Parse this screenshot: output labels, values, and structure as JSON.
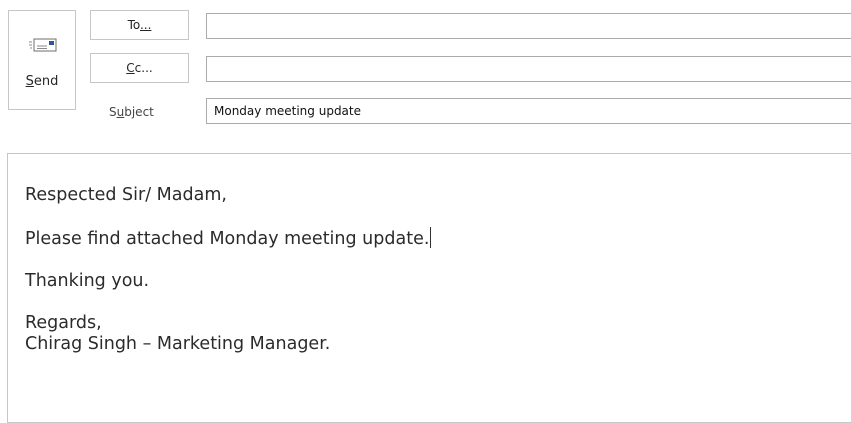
{
  "compose": {
    "send": {
      "label_prefix": "",
      "label_accesskey": "S",
      "label_rest": "end",
      "icon": "send-mail-icon"
    },
    "to": {
      "btn_prefix": "To",
      "btn_accesskey": "",
      "btn_suffix": "...",
      "value": ""
    },
    "cc": {
      "btn_accesskey": "C",
      "btn_rest": "c",
      "btn_suffix": "...",
      "value": ""
    },
    "subject": {
      "label_prefix": "S",
      "label_accesskey": "u",
      "label_rest": "bject",
      "value": "Monday meeting update"
    },
    "body": {
      "greeting": "Respected Sir/ Madam,",
      "line1": "Please find attached Monday meeting update.",
      "line2": "Thanking you.",
      "closing": "Regards,",
      "signature": "Chirag Singh – Marketing Manager."
    }
  },
  "colors": {
    "border": "#c6c6c6",
    "field_border": "#ababab",
    "icon_accent": "#2b579a"
  }
}
